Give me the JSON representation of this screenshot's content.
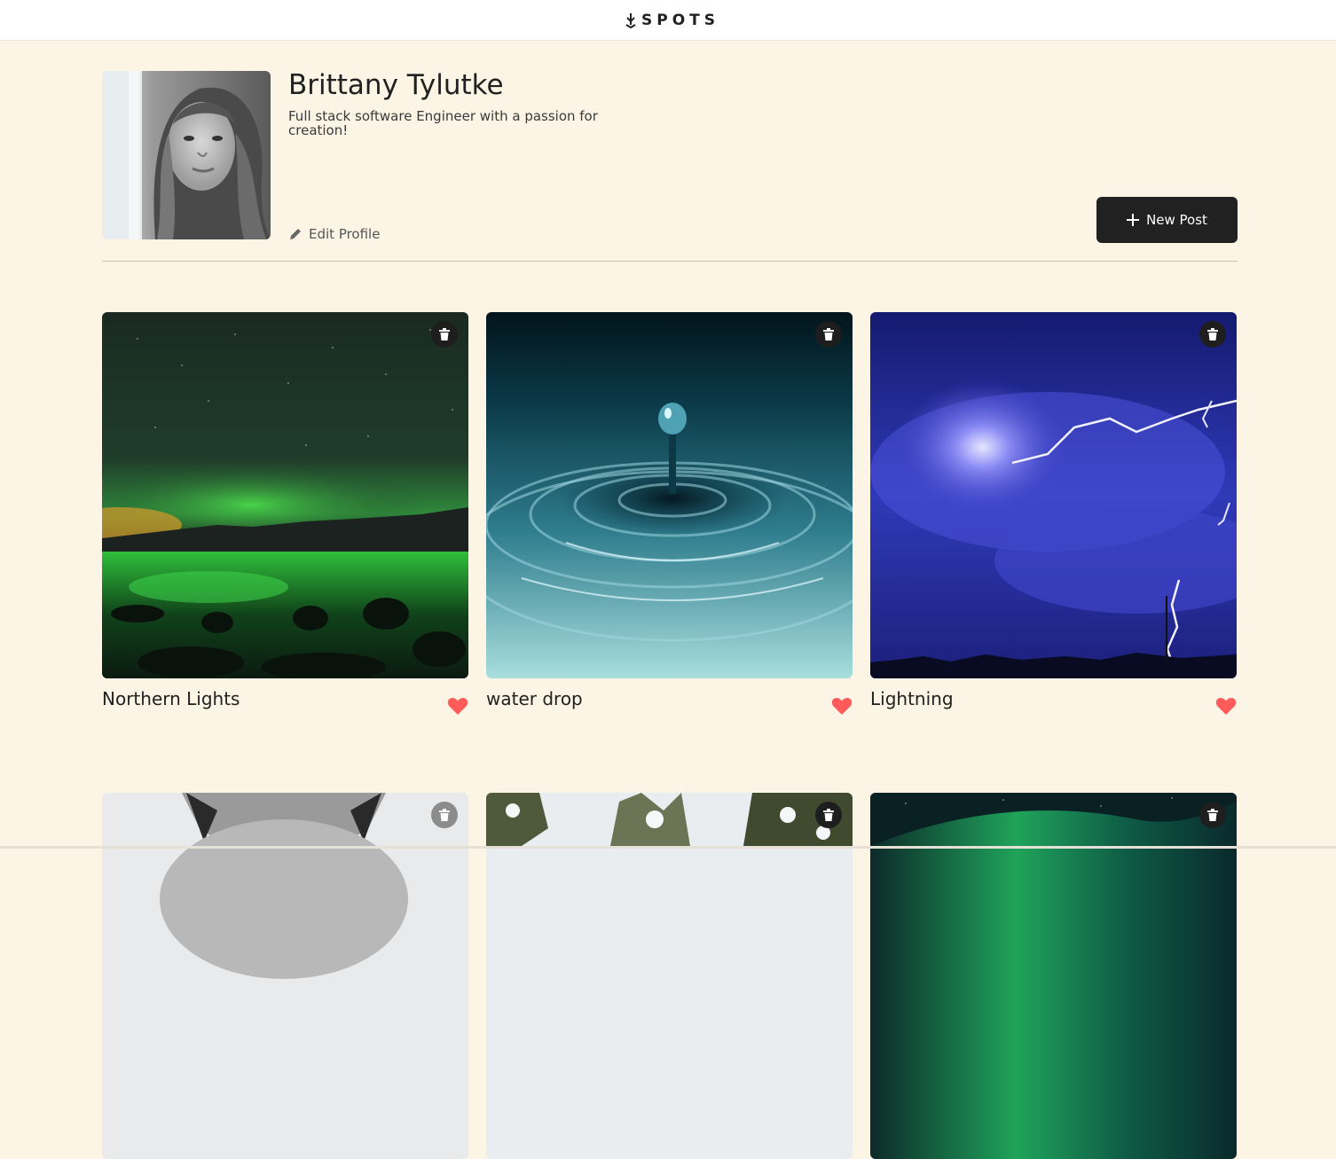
{
  "header": {
    "logo_text": "SPOTS",
    "logo_icon": "arrow-down-icon"
  },
  "profile": {
    "name": "Brittany Tylutke",
    "bio": "Full stack software Engineer with a passion for creation!",
    "edit_label": "Edit Profile",
    "new_post_label": "New Post"
  },
  "cards": [
    {
      "title": "Northern Lights",
      "liked": true
    },
    {
      "title": "water drop",
      "liked": true
    },
    {
      "title": "Lightning",
      "liked": true
    },
    {
      "title": "",
      "liked": false
    },
    {
      "title": "",
      "liked": false
    },
    {
      "title": "",
      "liked": false
    }
  ],
  "colors": {
    "background": "#fcf5e5",
    "button_dark": "#212121",
    "like_red": "#ff5b5b"
  }
}
